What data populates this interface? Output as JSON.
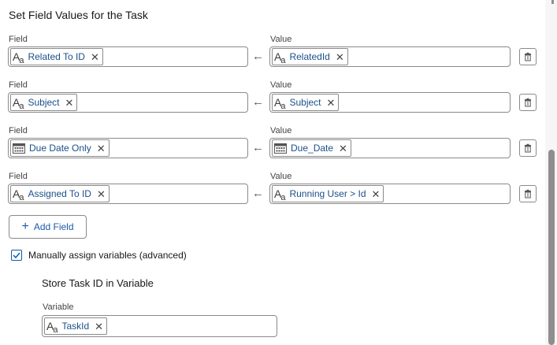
{
  "title": "Set Field Values for the Task",
  "field_label": "Field",
  "value_label": "Value",
  "mappings": [
    {
      "field": "Related To ID",
      "field_icon": "text-icon",
      "value": "RelatedId",
      "value_icon": "text-icon"
    },
    {
      "field": "Subject",
      "field_icon": "text-icon",
      "value": "Subject",
      "value_icon": "text-icon"
    },
    {
      "field": "Due Date Only",
      "field_icon": "calendar-icon",
      "value": "Due_Date",
      "value_icon": "calendar-icon"
    },
    {
      "field": "Assigned To ID",
      "field_icon": "text-icon",
      "value": "Running User > Id",
      "value_icon": "text-icon"
    }
  ],
  "icons": {
    "text_main": "A",
    "text_sub": "a",
    "remove": "✕",
    "arrow": "←",
    "plus": "+"
  },
  "add_field_label": "Add Field",
  "manual_assign": {
    "label": "Manually assign variables (advanced)",
    "checked": true
  },
  "store": {
    "title": "Store Task ID in Variable",
    "variable_label": "Variable",
    "variable_value": "TaskId"
  },
  "colors": {
    "accent": "#0b5cad",
    "pill_text": "#1b4f8a"
  }
}
